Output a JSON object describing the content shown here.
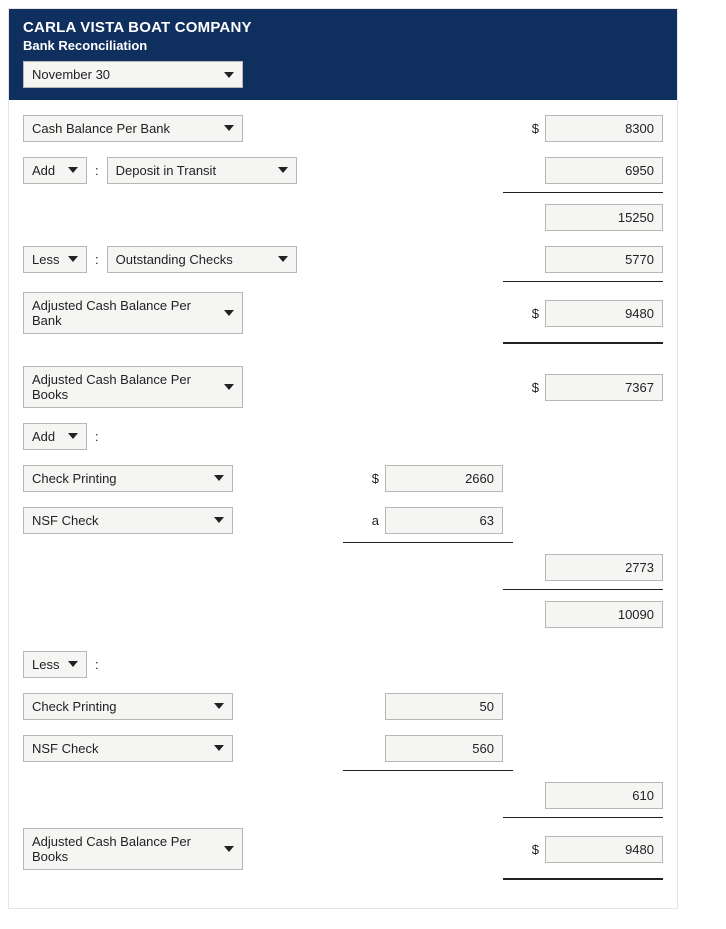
{
  "header": {
    "company": "CARLA VISTA BOAT COMPANY",
    "subtitle": "Bank Reconciliation",
    "date": "November 30"
  },
  "labels": {
    "cash_balance_per_bank": "Cash Balance Per Bank",
    "add": "Add",
    "less": "Less",
    "deposit_in_transit": "Deposit in Transit",
    "outstanding_checks": "Outstanding Checks",
    "adjusted_cash_balance_per_bank": "Adjusted Cash Balance Per Bank",
    "adjusted_cash_balance_per_books": "Adjusted Cash Balance Per Books",
    "check_printing": "Check Printing",
    "nsf_check": "NSF Check",
    "colon": ":",
    "dollar": "$",
    "a": "a"
  },
  "values": {
    "cash_balance_per_bank": "8300",
    "deposit_in_transit": "6950",
    "subtotal_bank_after_add": "15250",
    "outstanding_checks": "5770",
    "adjusted_cash_balance_per_bank": "9480",
    "adjusted_cash_balance_per_books_top": "7367",
    "add_check_printing": "2660",
    "add_nsf_check": "63",
    "add_subtotal": "2773",
    "books_after_add": "10090",
    "less_check_printing": "50",
    "less_nsf_check": "560",
    "less_subtotal": "610",
    "adjusted_cash_balance_per_books_bottom": "9480"
  }
}
